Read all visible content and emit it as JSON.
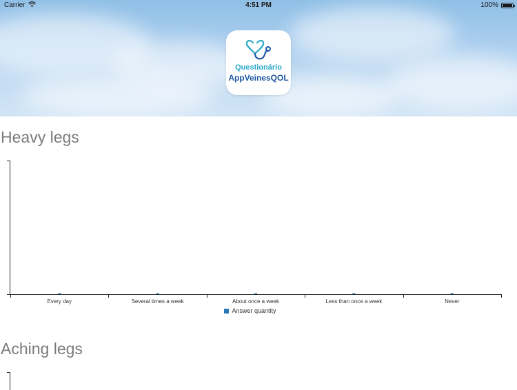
{
  "status_bar": {
    "carrier": "Carrier",
    "time": "4:51 PM",
    "battery": "100%"
  },
  "logo": {
    "line1": "Questionário",
    "line2": "AppVeinesQOL"
  },
  "sections": [
    {
      "title": "Heavy legs"
    },
    {
      "title": "Aching legs"
    }
  ],
  "colors": {
    "series": "#2a79b6",
    "title": "#7a7a7a"
  },
  "chart_data": {
    "type": "bar",
    "categories": [
      "Every day",
      "Several times a week",
      "About once a week",
      "Less than once a week",
      "Never"
    ],
    "series": [
      {
        "name": "Answer quantity",
        "values": [
          0,
          0,
          0,
          0,
          0
        ]
      }
    ],
    "legend": "bottom",
    "grid": false
  }
}
